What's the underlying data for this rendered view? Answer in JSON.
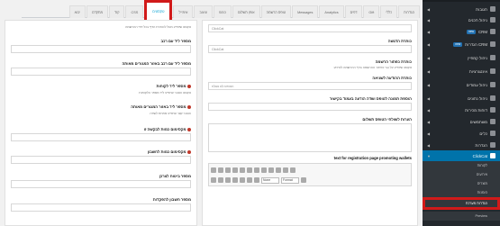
{
  "tabs": [
    {
      "label": "הגדרות"
    },
    {
      "label": "כללי"
    },
    {
      "label": "Gift"
    },
    {
      "label": "דפים"
    },
    {
      "label": "Analytics"
    },
    {
      "label": "Messages"
    },
    {
      "label": "טופס הרשמה"
    },
    {
      "label": "אופן תשלום"
    },
    {
      "label": "SEO"
    },
    {
      "label": "עיצוב"
    },
    {
      "label": "אימייל"
    },
    {
      "label": "טקסטים"
    },
    {
      "label": "CSS"
    },
    {
      "label": "קוד"
    },
    {
      "label": "מתקדם"
    },
    {
      "label": "יבוא"
    }
  ],
  "right_panel": {
    "f1_label": "",
    "f1_value": "ClickCat",
    "f2_label": "כותרת הדגשה",
    "f2_value": "ClickCat",
    "f3_label": "כותרת כפתור הרשמה",
    "f3_desc": "טקסט שיופיע על גבי כפתור ההרשמה בדף ההרשמה לאירוע",
    "f4_label": "כותרת ההודעה לשגיאה",
    "f4_value": "הטופס לא נשלח",
    "f5_label": "הוספת תמונה לטופס ושדה הודעה בעמוד בקישור",
    "f6_label": "הערות לשולחי הטופס תשלום",
    "f7_label": "text for registration page promoting wallets",
    "editor": {
      "paragraph": "None",
      "format": "Format"
    }
  },
  "left_panel": {
    "top_desc": "טקסט שיופיע מעל לכותרת הדף בכל דפי ההרשמה",
    "f1_label": "מספר ליד עם רכב",
    "f2_label": "מספר ליד עם רכב באזור המגורים מאותה",
    "f3_label": "מספר ליד לקוחות",
    "f3_desc": "טקסט הסבר שיופיע ליד מספר הלקוחות",
    "f4_label": "מספר ליד באזור המגורים מאותה",
    "f4_desc": "הסבר קצר שיופיע מתחת לשדה",
    "f5_label": "מקסימום כמות לבקשה זו",
    "f6_label": "מקסימום כמות לחשבון",
    "f7_label": "מספר ביטוח לצרכן",
    "f8_label": "מספר חשבון להפקדות"
  },
  "sidebar": {
    "items": [
      {
        "label": "תגובות"
      },
      {
        "label": "ניהול תכנים"
      },
      {
        "label": "CRM",
        "badge": "new"
      },
      {
        "label": "הגדרות CRM",
        "badge": "new"
      },
      {
        "label": "ניהול קמפיין"
      },
      {
        "label": "אינטגרציות"
      },
      {
        "label": "ניהול עמודים"
      },
      {
        "label": "ניהול נתונים"
      },
      {
        "label": "דוחות מכירות"
      },
      {
        "label": "משתמשים"
      },
      {
        "label": "כלים"
      },
      {
        "label": "הגדרות"
      }
    ],
    "active": "ClickCat",
    "subitems": [
      {
        "label": "לקוחות"
      },
      {
        "label": "אירועים"
      },
      {
        "label": "מוצרים"
      },
      {
        "label": "הזמנות"
      },
      {
        "label": "הגדרות מערכת"
      },
      {
        "label": "Preview"
      }
    ]
  },
  "colors": {
    "accent": "#0073aa",
    "highlight_outline": "#d11a1a",
    "sidebar_bg": "#23282d"
  }
}
